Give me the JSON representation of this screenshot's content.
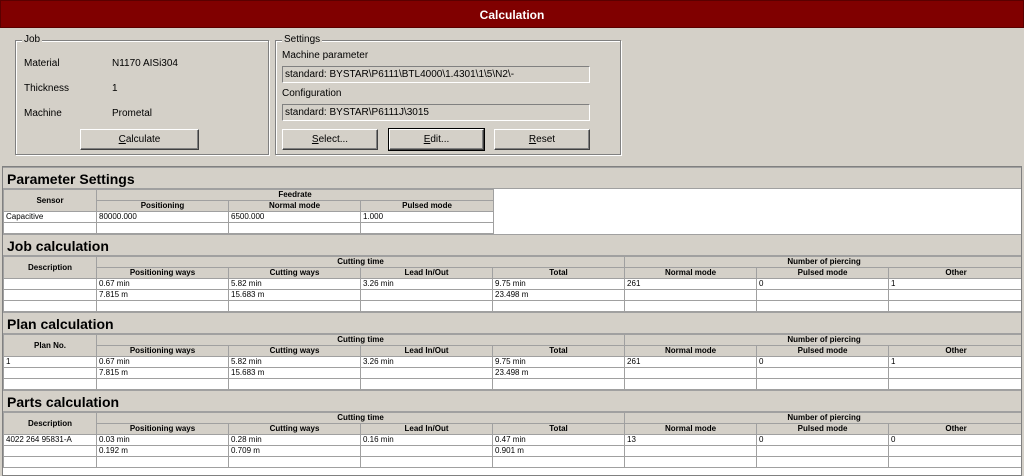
{
  "window": {
    "title": "Calculation"
  },
  "job": {
    "legend": "Job",
    "material_label": "Material",
    "material_value": "N1170 AISi304",
    "thickness_label": "Thickness",
    "thickness_value": "1",
    "machine_label": "Machine",
    "machine_value": "Prometal",
    "calculate_pre": "",
    "calculate_u": "C",
    "calculate_post": "alculate"
  },
  "settings": {
    "legend": "Settings",
    "machine_param_label": "Machine parameter",
    "machine_param_value": "standard: BYSTAR\\P6111\\BTL4000\\1.4301\\1\\5\\N2\\-",
    "configuration_label": "Configuration",
    "configuration_value": "standard: BYSTAR\\P6111J\\3015",
    "select_u": "S",
    "select_post": "elect...",
    "edit_u": "E",
    "edit_post": "dit...",
    "reset_u": "R",
    "reset_post": "eset"
  },
  "report": {
    "param_settings": {
      "title": "Parameter Settings",
      "sensor_header": "Sensor",
      "feedrate_header": "Feedrate",
      "positioning_header": "Positioning",
      "normal_header": "Normal mode",
      "pulsed_header": "Pulsed mode",
      "row": {
        "sensor": "Capacitive",
        "positioning": "80000.000",
        "normal": "6500.000",
        "pulsed": "1.000"
      }
    },
    "job_calc": {
      "title": "Job calculation",
      "first_header": "Description",
      "cutting_time_header": "Cutting time",
      "piercing_header": "Number of piercing",
      "cols": [
        "Positioning ways",
        "Cutting ways",
        "Lead In/Out",
        "Total",
        "Normal mode",
        "Pulsed mode",
        "Other"
      ],
      "row1": [
        "",
        "0.67 min",
        "5.82 min",
        "3.26 min",
        "9.75 min",
        "261",
        "0",
        "1"
      ],
      "row2": [
        "",
        "7.815 m",
        "15.683 m",
        "",
        "23.498 m",
        "",
        "",
        ""
      ]
    },
    "plan_calc": {
      "title": "Plan calculation",
      "first_header": "Plan No.",
      "cutting_time_header": "Cutting time",
      "piercing_header": "Number of piercing",
      "cols": [
        "Positioning ways",
        "Cutting ways",
        "Lead In/Out",
        "Total",
        "Normal mode",
        "Pulsed mode",
        "Other"
      ],
      "row1": [
        "1",
        "0.67 min",
        "5.82 min",
        "3.26 min",
        "9.75 min",
        "261",
        "0",
        "1"
      ],
      "row2": [
        "",
        "7.815 m",
        "15.683 m",
        "",
        "23.498 m",
        "",
        "",
        ""
      ]
    },
    "parts_calc": {
      "title": "Parts calculation",
      "first_header": "Description",
      "cutting_time_header": "Cutting time",
      "piercing_header": "Number of piercing",
      "cols": [
        "Positioning ways",
        "Cutting ways",
        "Lead In/Out",
        "Total",
        "Normal mode",
        "Pulsed mode",
        "Other"
      ],
      "row1": [
        "4022 264 95831-A",
        "0.03 min",
        "0.28 min",
        "0.16 min",
        "0.47 min",
        "13",
        "0",
        "0"
      ],
      "row2": [
        "",
        "0.192 m",
        "0.709 m",
        "",
        "0.901 m",
        "",
        "",
        ""
      ]
    }
  }
}
